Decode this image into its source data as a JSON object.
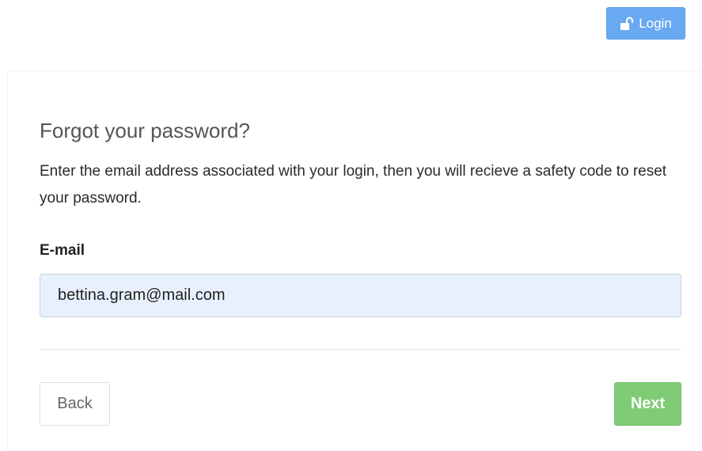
{
  "header": {
    "login_label": "Login",
    "login_icon": "unlock-icon"
  },
  "form": {
    "title": "Forgot your password?",
    "description": "Enter the email address associated with your login, then you will recieve a safety code to reset your password.",
    "email_label": "E-mail",
    "email_value": "bettina.gram@mail.com"
  },
  "actions": {
    "back_label": "Back",
    "next_label": "Next"
  },
  "colors": {
    "login_button": "#69a9f2",
    "next_button": "#7fcb76",
    "input_background": "#e8f0fe"
  }
}
